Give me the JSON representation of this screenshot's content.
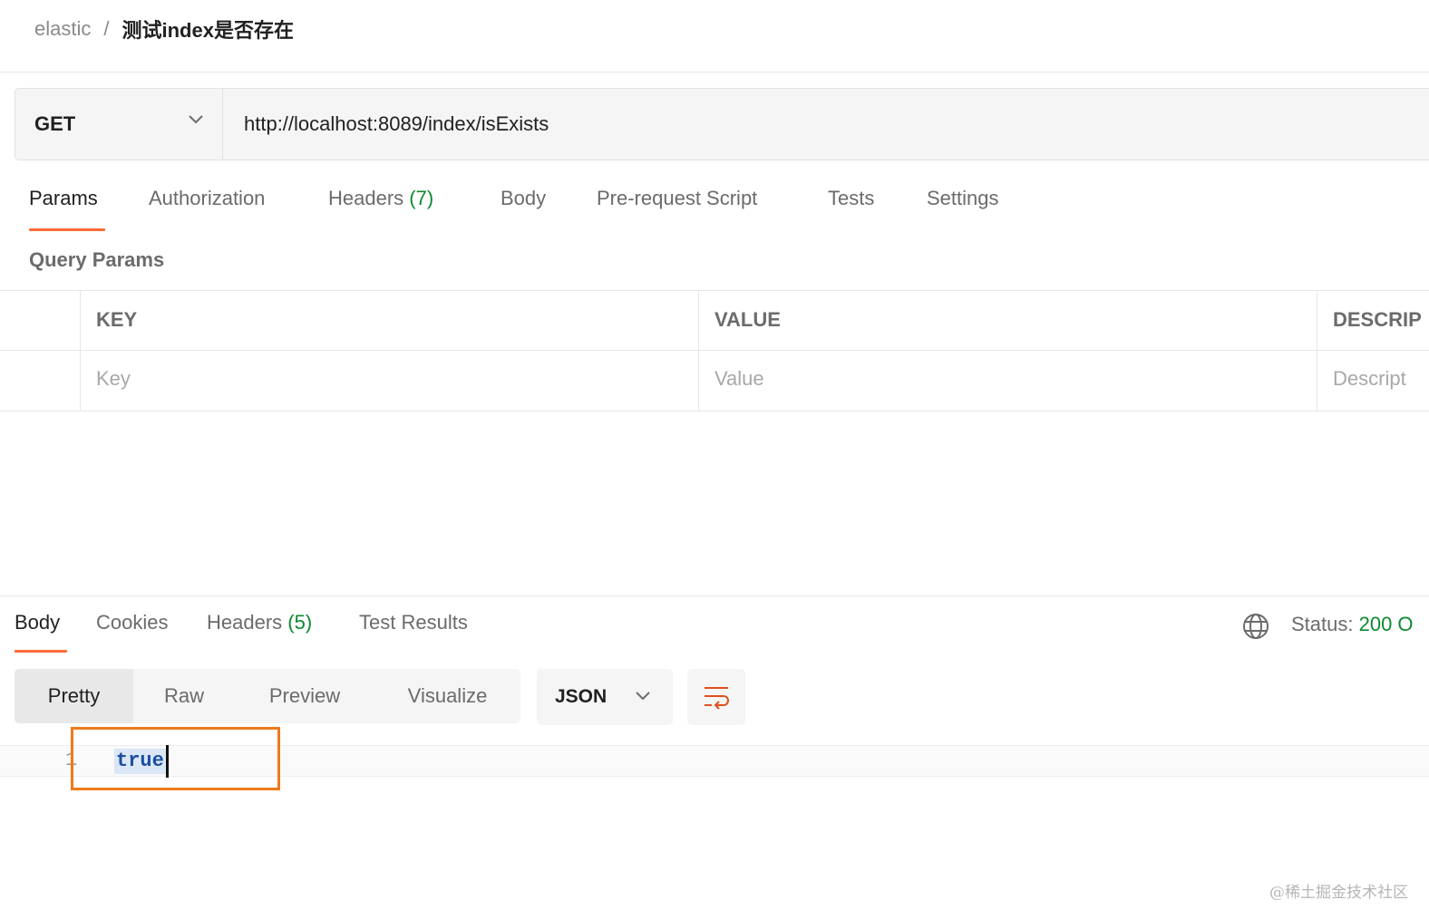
{
  "breadcrumb": {
    "root": "elastic",
    "separator": "/",
    "current": "测试index是否存在"
  },
  "request": {
    "method": "GET",
    "url": "http://localhost:8089/index/isExists"
  },
  "request_tabs": [
    {
      "label": "Params",
      "count": "",
      "active": true
    },
    {
      "label": "Authorization",
      "count": ""
    },
    {
      "label": "Headers",
      "count": "(7)"
    },
    {
      "label": "Body",
      "count": ""
    },
    {
      "label": "Pre-request Script",
      "count": ""
    },
    {
      "label": "Tests",
      "count": ""
    },
    {
      "label": "Settings",
      "count": ""
    }
  ],
  "query_params": {
    "title": "Query Params",
    "columns": [
      "KEY",
      "VALUE",
      "DESCRIP"
    ],
    "placeholders": [
      "Key",
      "Value",
      "Descript"
    ]
  },
  "response": {
    "tabs": [
      {
        "label": "Body",
        "count": "",
        "active": true
      },
      {
        "label": "Cookies",
        "count": ""
      },
      {
        "label": "Headers",
        "count": "(5)"
      },
      {
        "label": "Test Results",
        "count": ""
      }
    ],
    "status_label": "Status:",
    "status_value": "200 O",
    "format_buttons": [
      "Pretty",
      "Raw",
      "Preview",
      "Visualize"
    ],
    "active_format": "Pretty",
    "language": "JSON",
    "code_lines": [
      {
        "number": "1",
        "text": "true"
      }
    ]
  },
  "icons": {
    "method_chevron": "chevron-down-icon",
    "language_chevron": "chevron-down-icon",
    "network": "globe-icon",
    "wrap": "wrap-lines-icon"
  },
  "colors": {
    "accent": "#ff6c37",
    "success": "#0b8a2e",
    "highlight_box": "#ee7a1c",
    "code_keyword": "#1a4fa0"
  },
  "watermark": "@稀土掘金技术社区"
}
